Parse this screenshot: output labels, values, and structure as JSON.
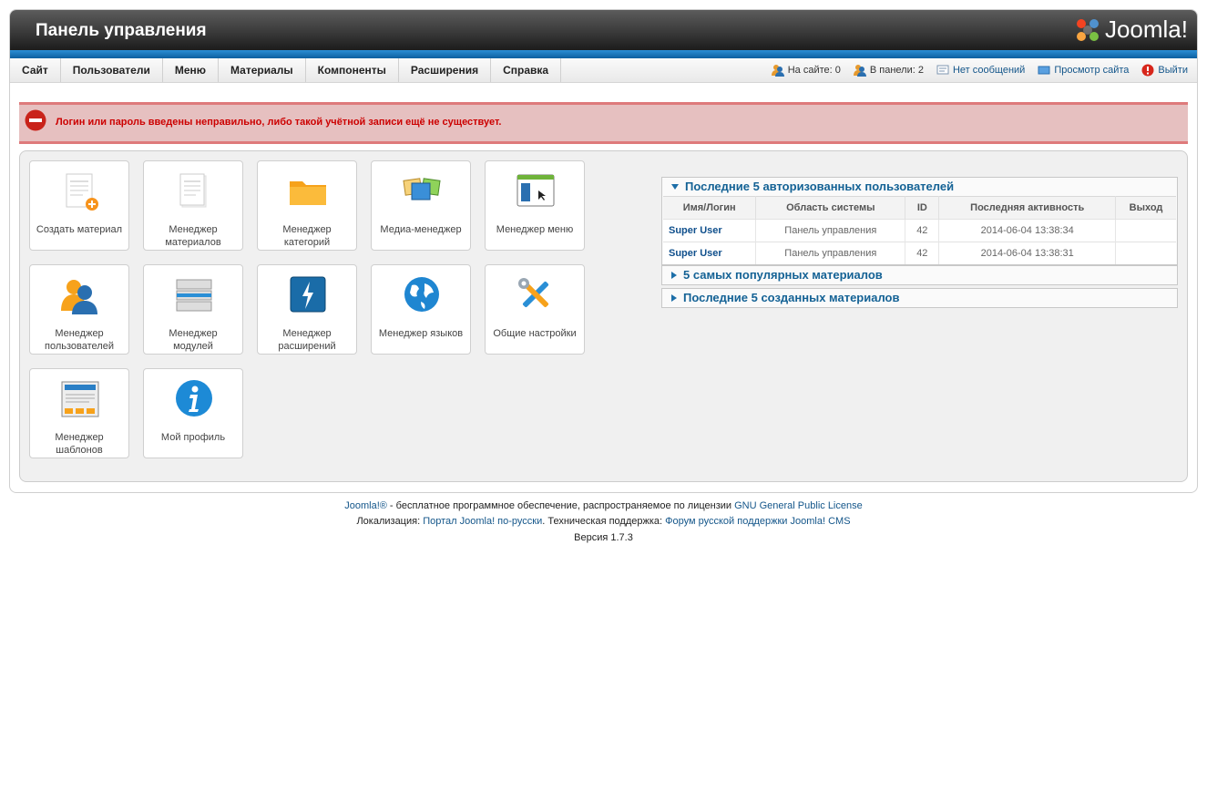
{
  "header": {
    "title": "Панель управления",
    "logo_text": "Joomla!"
  },
  "menu": {
    "items": [
      {
        "label": "Сайт"
      },
      {
        "label": "Пользователи"
      },
      {
        "label": "Меню"
      },
      {
        "label": "Материалы"
      },
      {
        "label": "Компоненты"
      },
      {
        "label": "Расширения"
      },
      {
        "label": "Справка"
      }
    ]
  },
  "status": {
    "on_site": "На сайте: 0",
    "in_panel": "В панели: 2",
    "messages": "Нет сообщений",
    "view_site": "Просмотр сайта",
    "logout": "Выйти"
  },
  "alert": {
    "text": "Логин или пароль введены неправильно, либо такой учётной записи ещё не существует."
  },
  "quickicons": [
    {
      "label": "Создать материал",
      "icon": "article-add-icon"
    },
    {
      "label": "Менеджер материалов",
      "icon": "article-icon"
    },
    {
      "label": "Менеджер категорий",
      "icon": "folder-icon"
    },
    {
      "label": "Медиа-менеджер",
      "icon": "media-icon"
    },
    {
      "label": "Менеджер меню",
      "icon": "menu-icon"
    },
    {
      "label": "Менеджер пользователей",
      "icon": "users-icon"
    },
    {
      "label": "Менеджер модулей",
      "icon": "modules-icon"
    },
    {
      "label": "Менеджер расширений",
      "icon": "extensions-icon"
    },
    {
      "label": "Менеджер языков",
      "icon": "globe-icon"
    },
    {
      "label": "Общие настройки",
      "icon": "tools-icon"
    },
    {
      "label": "Менеджер шаблонов",
      "icon": "template-icon"
    },
    {
      "label": "Мой профиль",
      "icon": "info-icon"
    }
  ],
  "modules": {
    "logged": {
      "title": "Последние 5 авторизованных пользователей",
      "columns": [
        "Имя/Логин",
        "Область системы",
        "ID",
        "Последняя активность",
        "Выход"
      ],
      "rows": [
        [
          "Super User",
          "Панель управления",
          "42",
          "2014-06-04 13:38:34",
          ""
        ],
        [
          "Super User",
          "Панель управления",
          "42",
          "2014-06-04 13:38:31",
          ""
        ]
      ]
    },
    "popular": {
      "title": "5 самых популярных материалов"
    },
    "latest": {
      "title": "Последние 5 созданных материалов"
    }
  },
  "footer": {
    "line1_link1": "Joomla!®",
    "line1_text": " - бесплатное программное обеспечение, распространяемое по лицензии ",
    "line1_link2": "GNU General Public License",
    "line2_text1": "Локализация: ",
    "line2_link1": "Портал Joomla! по-русски",
    "line2_text2": ". Техническая поддержка: ",
    "line2_link2": "Форум русской поддержки Joomla! CMS",
    "version": "Версия 1.7.3"
  },
  "colors": {
    "accent": "#14568a",
    "alert_bg": "#e6c0c0",
    "alert_text": "#cc0000",
    "blue_band": "#1a78c2"
  }
}
